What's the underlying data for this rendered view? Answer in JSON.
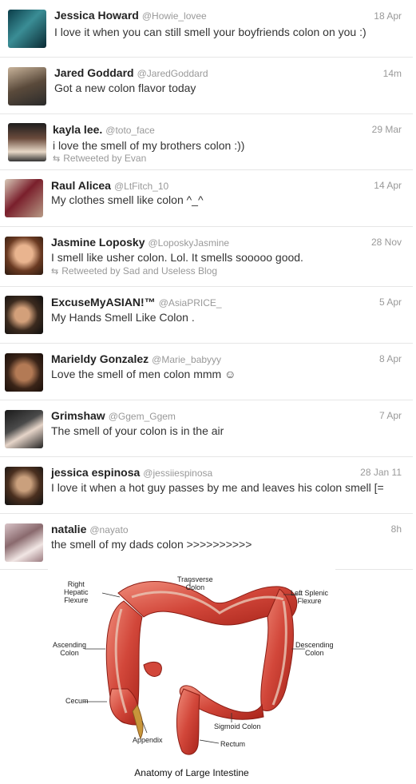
{
  "tweets": [
    {
      "name": "Jessica Howard",
      "handle": "@Howie_lovee",
      "time": "18 Apr",
      "text": "I love it when you can still smell your boyfriends colon on you :)",
      "retweet": ""
    },
    {
      "name": "Jared Goddard",
      "handle": "@JaredGoddard",
      "time": "14m",
      "text": "Got a new colon flavor today",
      "retweet": ""
    },
    {
      "name": "kayla lee.",
      "handle": "@toto_face",
      "time": "29 Mar",
      "text": "i love the smell of my brothers colon :))",
      "retweet": "Retweeted by Evan"
    },
    {
      "name": "Raul Alicea",
      "handle": "@LtFitch_10",
      "time": "14 Apr",
      "text": "My clothes smell like colon ^_^",
      "retweet": ""
    },
    {
      "name": "Jasmine Loposky",
      "handle": "@LoposkyJasmine",
      "time": "28 Nov",
      "text": "I smell like usher colon. Lol. It smells sooooo good.",
      "retweet": "Retweeted by Sad and Useless Blog"
    },
    {
      "name": "ExcuseMyASIAN!™",
      "handle": "@AsiaPRICE_",
      "time": "5 Apr",
      "text": "My Hands Smell Like Colon .",
      "retweet": ""
    },
    {
      "name": "Marieldy Gonzalez",
      "handle": "@Marie_babyyy",
      "time": "8 Apr",
      "text": "Love the smell of men colon mmm ☺",
      "retweet": ""
    },
    {
      "name": "Grimshaw",
      "handle": "@Ggem_Ggem",
      "time": "7 Apr",
      "text": "The smell of your colon is in the air",
      "retweet": ""
    },
    {
      "name": "jessica espinosa",
      "handle": "@jessiiespinosa",
      "time": "28 Jan 11",
      "text": "I love it when a hot guy passes by me and leaves his colon smell [=",
      "retweet": ""
    },
    {
      "name": "natalie",
      "handle": "@nayato",
      "time": "8h",
      "text": "the smell of my dads colon >>>>>>>>>>",
      "retweet": ""
    }
  ],
  "diagram": {
    "labels": {
      "right_hepatic": "Right\nHepatic\nFlexure",
      "transverse": "Transverse\nColon",
      "left_splenic": "Left Splenic\nFlexure",
      "ascending": "Ascending\nColon",
      "descending": "Descending\nColon",
      "cecum": "Cecum",
      "appendix": "Appendix",
      "sigmoid": "Sigmoid Colon",
      "rectum": "Rectum"
    },
    "title": "Anatomy of Large Intestine"
  },
  "colors": {
    "colon_dark": "#a8241a",
    "colon_mid": "#d2473a",
    "colon_light": "#f08c7a",
    "band": "#e9c7b6"
  }
}
